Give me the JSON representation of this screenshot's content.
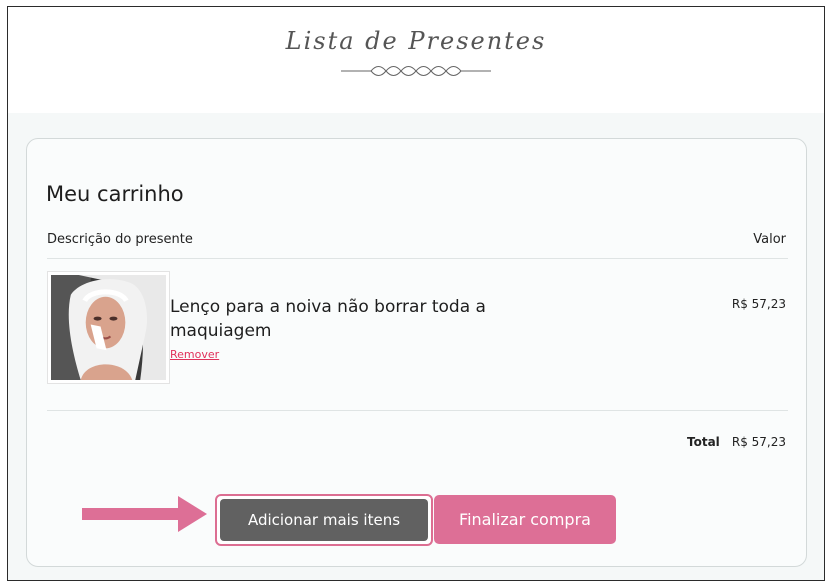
{
  "header": {
    "title": "Lista de Presentes",
    "ornament_icon": "ornament-divider-icon"
  },
  "cart": {
    "title": "Meu carrinho",
    "columns": {
      "description": "Descrição do presente",
      "value": "Valor"
    },
    "items": [
      {
        "image_icon": "bride-photo",
        "name": "Lenço para a noiva não borrar toda a maquiagem",
        "remove_label": "Remover",
        "price": "R$ 57,23"
      }
    ],
    "total": {
      "label": "Total",
      "value": "R$ 57,23"
    }
  },
  "actions": {
    "add_more_label": "Adicionar mais itens",
    "finish_label": "Finalizar compra",
    "pointer_icon": "arrow-right-icon"
  },
  "colors": {
    "accent_pink": "#dd6f96",
    "dark_button": "#616161",
    "remove_link": "#e0315a"
  }
}
